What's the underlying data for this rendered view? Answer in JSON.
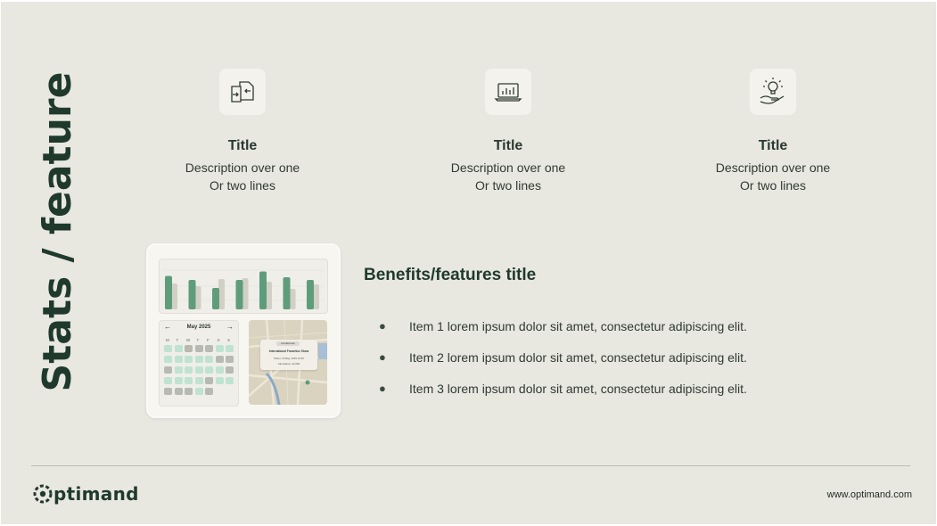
{
  "slide": {
    "vertical_title": "Stats / feature"
  },
  "features": [
    {
      "title": "Title",
      "line1": "Description over one",
      "line2": "Or two lines",
      "icon": "document-exchange-icon"
    },
    {
      "title": "Title",
      "line1": "Description over one",
      "line2": "Or two lines",
      "icon": "laptop-chart-icon"
    },
    {
      "title": "Title",
      "line1": "Description over one",
      "line2": "Or two lines",
      "icon": "hand-lightbulb-icon"
    }
  ],
  "mockup": {
    "bars": [
      {
        "green": 0.75,
        "grey": 0.58
      },
      {
        "green": 0.66,
        "grey": 0.52
      },
      {
        "green": 0.48,
        "grey": 0.68
      },
      {
        "green": 0.66,
        "grey": 0.7
      },
      {
        "green": 0.85,
        "grey": 0.62
      },
      {
        "green": 0.72,
        "grey": 0.46
      },
      {
        "green": 0.66,
        "grey": 0.56
      }
    ],
    "calendar": {
      "month": "May 2025",
      "weekdays": [
        "M",
        "T",
        "W",
        "T",
        "F",
        "S",
        "S"
      ]
    },
    "map_card": {
      "badge": "Conference",
      "event": "International Franchise Show",
      "when": "When: 15 May, 2025 12:00",
      "attendance": "Attendance: 22,000"
    }
  },
  "benefits": {
    "title": "Benefits/features title",
    "items": [
      "Item 1 lorem ipsum dolor sit amet, consectetur adipiscing elit.",
      "Item 2 lorem ipsum dolor sit amet, consectetur adipiscing elit.",
      "Item 3 lorem ipsum dolor sit amet, consectetur adipiscing elit."
    ],
    "bullet_char": "●"
  },
  "footer": {
    "logo_text": "ptimand",
    "url": "www.optimand.com"
  },
  "colors": {
    "background": "#e8e7e0",
    "accent_green": "#5f9c7c",
    "dark_green": "#1f3a2c"
  }
}
